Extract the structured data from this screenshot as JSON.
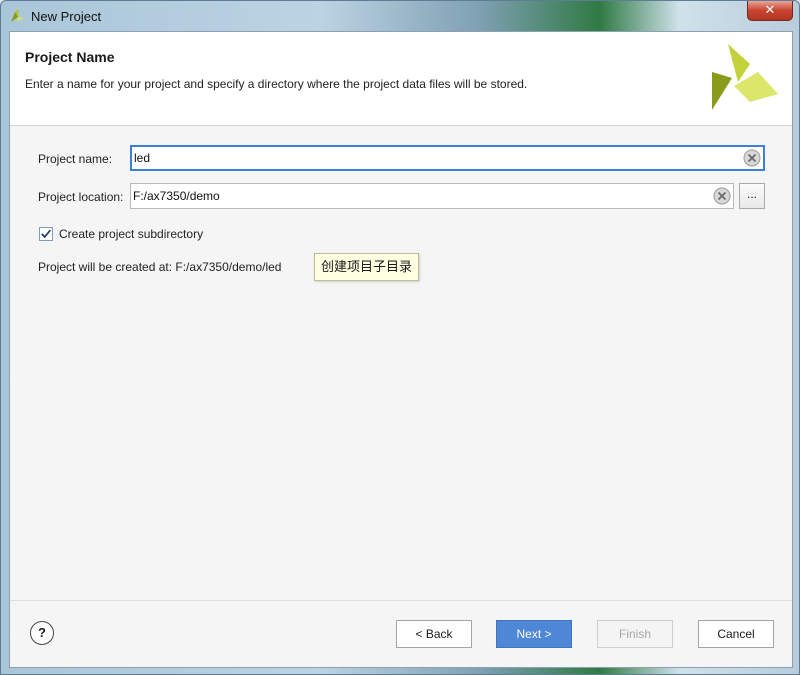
{
  "window": {
    "title": "New Project",
    "close_glyph": "✕"
  },
  "header": {
    "title": "Project Name",
    "description": "Enter a name for your project and specify a directory where the project data files will be stored."
  },
  "form": {
    "project_name_label": "Project name:",
    "project_name_value": "led",
    "project_location_label": "Project location:",
    "project_location_value": "F:/ax7350/demo",
    "browse_label": "...",
    "create_subdir_label": "Create project subdirectory",
    "create_subdir_checked": true,
    "result_text": "Project will be created at: F:/ax7350/demo/led",
    "tooltip_text": "创建项目子目录"
  },
  "footer": {
    "help_label": "?",
    "back_label": "< Back",
    "next_label": "Next >",
    "finish_label": "Finish",
    "cancel_label": "Cancel"
  },
  "colors": {
    "accent": "#4d87d6",
    "logo_dark": "#8a9a1a",
    "logo_light": "#d4e25a"
  },
  "icons": {
    "app_logo": "xilinx-logo-icon",
    "clear": "clear-circle-x-icon",
    "check": "checkmark-icon",
    "help": "question-mark-icon"
  }
}
